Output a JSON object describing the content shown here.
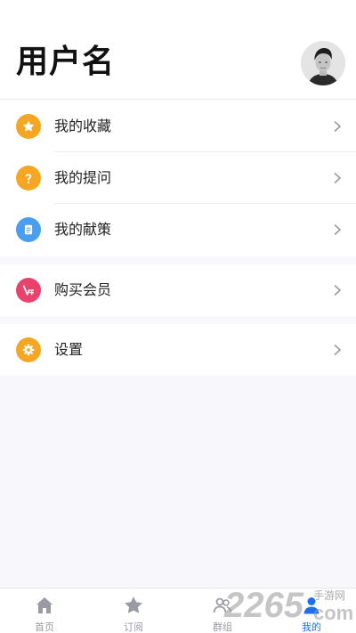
{
  "header": {
    "username": "用户名",
    "avatar_icon": "user-avatar"
  },
  "menu_group_1": [
    {
      "label": "我的收藏",
      "icon": "star-icon",
      "color": "#f5a623"
    },
    {
      "label": "我的提问",
      "icon": "question-icon",
      "color": "#f5a623"
    },
    {
      "label": "我的献策",
      "icon": "document-icon",
      "color": "#4a9ef0"
    }
  ],
  "menu_group_2": [
    {
      "label": "购买会员",
      "icon": "vip-icon",
      "color": "#e8436d"
    }
  ],
  "menu_group_3": [
    {
      "label": "设置",
      "icon": "gear-icon",
      "color": "#f5a623"
    }
  ],
  "tabbar": {
    "tabs": [
      {
        "label": "首页",
        "icon": "home-icon",
        "active": false
      },
      {
        "label": "订阅",
        "icon": "star-icon",
        "active": false
      },
      {
        "label": "群组",
        "icon": "group-icon",
        "active": false
      },
      {
        "label": "我的",
        "icon": "person-icon",
        "active": true
      }
    ],
    "active_color": "#1f6fe8",
    "inactive_color": "#9a9aa2"
  },
  "watermark": {
    "number": "2265",
    "site_text": "手游网",
    "suffix": "com"
  }
}
